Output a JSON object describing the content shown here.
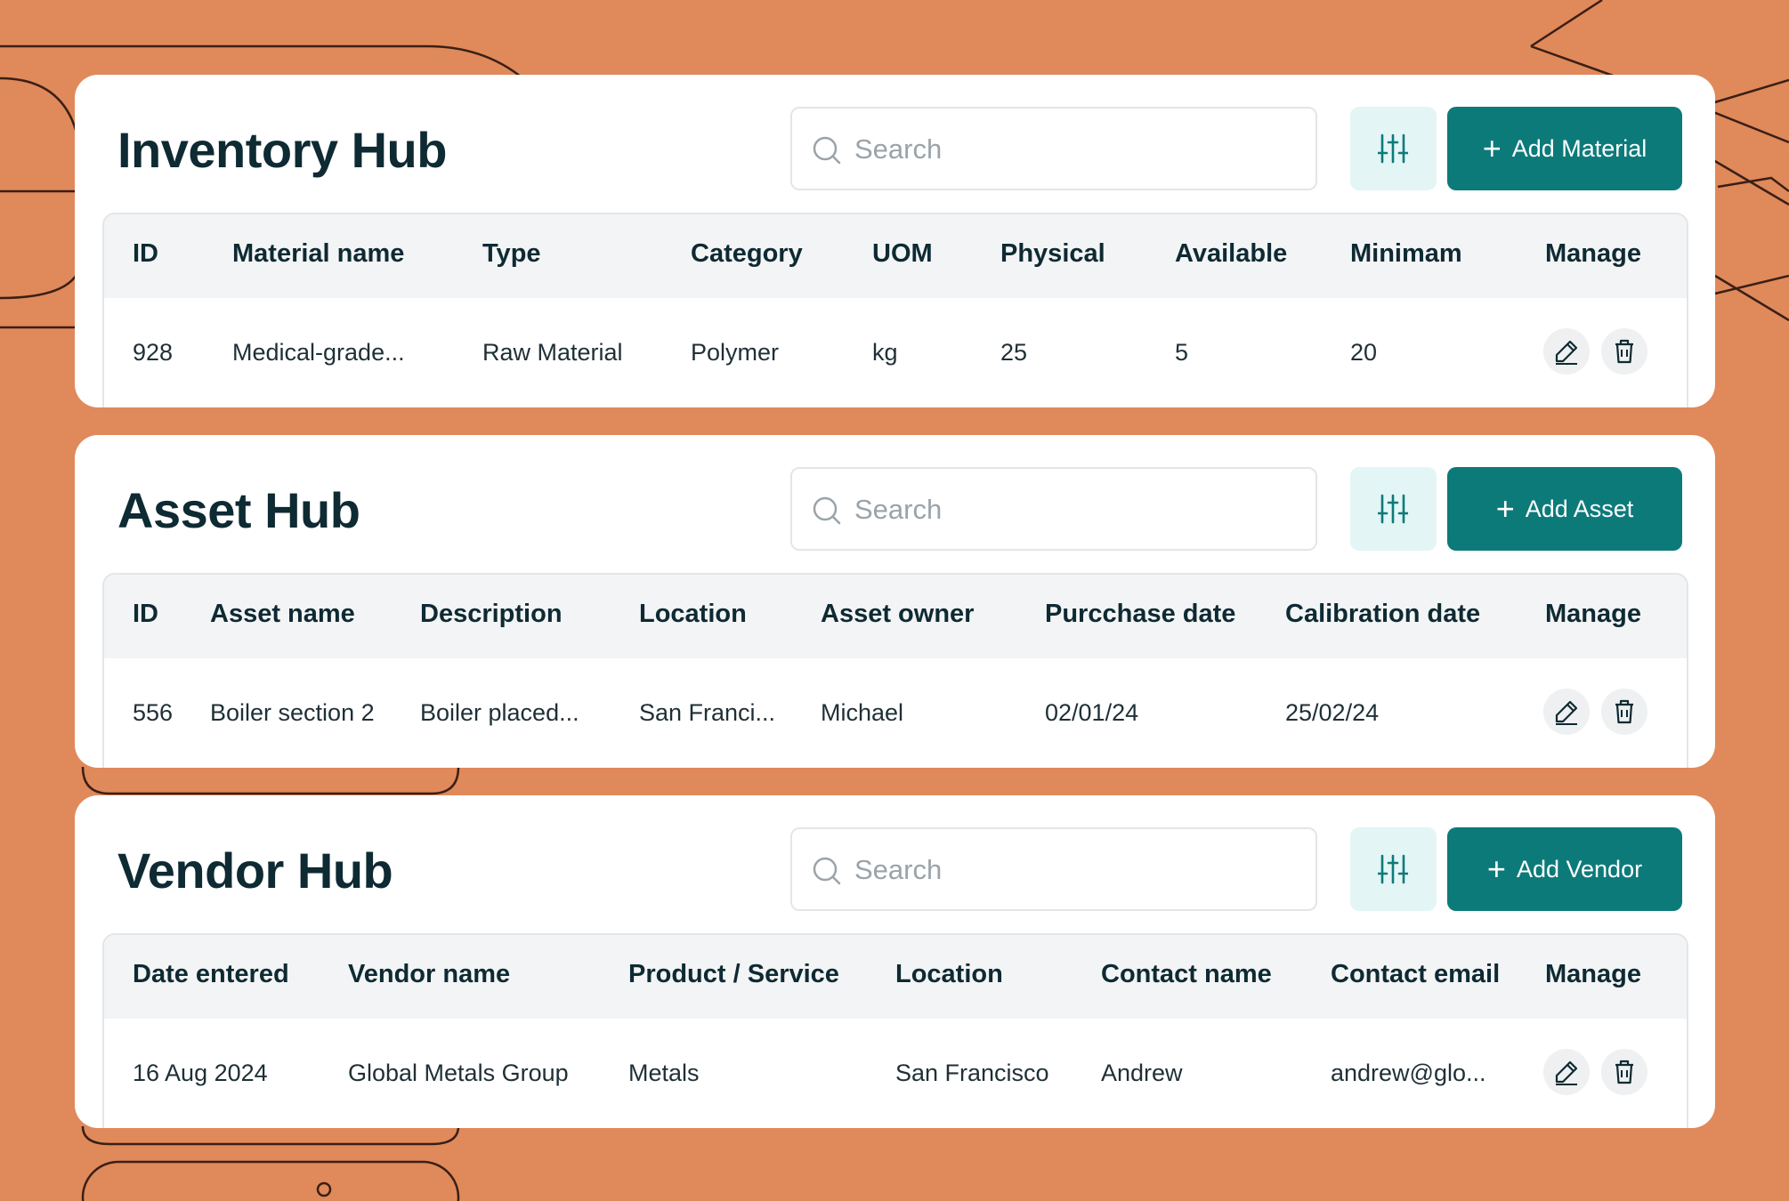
{
  "hubs": {
    "inventory": {
      "title": "Inventory Hub",
      "search_placeholder": "Search",
      "add_label": "Add Material",
      "columns": [
        "ID",
        "Material name",
        "Type",
        "Category",
        "UOM",
        "Physical",
        "Available",
        "Minimam",
        "Manage"
      ],
      "row": [
        "928",
        "Medical-grade...",
        "Raw Material",
        "Polymer",
        "kg",
        "25",
        "5",
        "20"
      ]
    },
    "asset": {
      "title": "Asset Hub",
      "search_placeholder": "Search",
      "add_label": "Add Asset",
      "columns": [
        "ID",
        "Asset name",
        "Description",
        "Location",
        "Asset owner",
        "Purcchase date",
        "Calibration date",
        "Manage"
      ],
      "row": [
        "556",
        "Boiler section 2",
        "Boiler placed...",
        "San Franci...",
        "Michael",
        "02/01/24",
        "25/02/24"
      ]
    },
    "vendor": {
      "title": "Vendor Hub",
      "search_placeholder": "Search",
      "add_label": "Add Vendor",
      "columns": [
        "Date entered",
        "Vendor name",
        "Product / Service",
        "Location",
        "Contact name",
        "Contact email",
        "Manage"
      ],
      "row": [
        "16 Aug 2024",
        "Global Metals Group",
        "Metals",
        "San Francisco",
        "Andrew",
        "andrew@glo..."
      ]
    }
  },
  "icons": {
    "search": "search-icon",
    "filter": "sliders-icon",
    "add": "plus-icon",
    "edit": "pencil-icon",
    "delete": "trash-icon"
  },
  "colors": {
    "background": "#e0895a",
    "accent": "#0d7a7a",
    "accent_light": "#e3f5f5",
    "text": "#0e2a33"
  }
}
